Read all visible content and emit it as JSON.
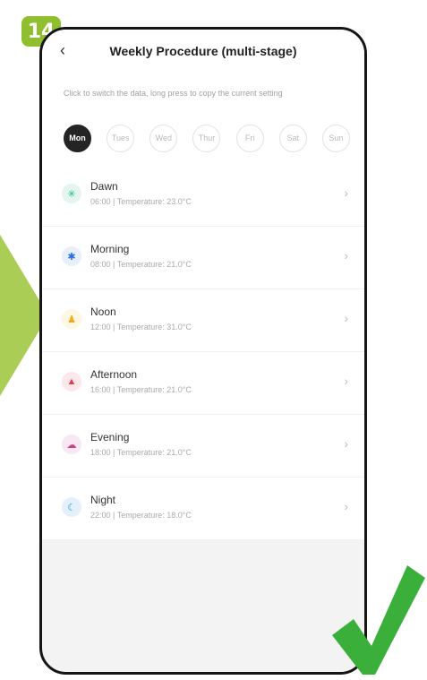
{
  "step": {
    "number": "14"
  },
  "header": {
    "back_icon": "chevron-left-icon",
    "title": "Weekly Procedure (multi-stage)",
    "hint": "Click to switch the data, long press to copy the current setting"
  },
  "days": [
    "Mon",
    "Tues",
    "Wed",
    "Thur",
    "Fri",
    "Sat",
    "Sun"
  ],
  "selected_day": "Mon",
  "stages": [
    {
      "name": "Dawn",
      "detail": "06:00 | Temperature: 23.0°C",
      "icon": "sunrise-icon",
      "glyph": "✳",
      "bg": "#e3f5ef",
      "fg": "#25b090"
    },
    {
      "name": "Morning",
      "detail": "08:00 | Temperature: 21.0°C",
      "icon": "sun-icon",
      "glyph": "✱",
      "bg": "#e7effb",
      "fg": "#2a6fe0"
    },
    {
      "name": "Noon",
      "detail": "12:00 | Temperature: 31.0°C",
      "icon": "person-icon",
      "glyph": "♟",
      "bg": "#fdf6e0",
      "fg": "#f0a818"
    },
    {
      "name": "Afternoon",
      "detail": "16:00 | Temperature: 21.0°C",
      "icon": "home-icon",
      "glyph": "▲",
      "bg": "#fce8ea",
      "fg": "#e24050"
    },
    {
      "name": "Evening",
      "detail": "18:00 | Temperature: 21.0°C",
      "icon": "cloud-moon-icon",
      "glyph": "☁",
      "bg": "#f7e8f2",
      "fg": "#c8408a"
    },
    {
      "name": "Night",
      "detail": "22:00 | Temperature: 18.0°C",
      "icon": "moon-icon",
      "glyph": "☾",
      "bg": "#e4f1fb",
      "fg": "#2899dd"
    }
  ],
  "colors": {
    "badge": "#8fbf2f",
    "arrow": "#a9cd55",
    "check": "#3ab03a",
    "active_day": "#242424"
  }
}
